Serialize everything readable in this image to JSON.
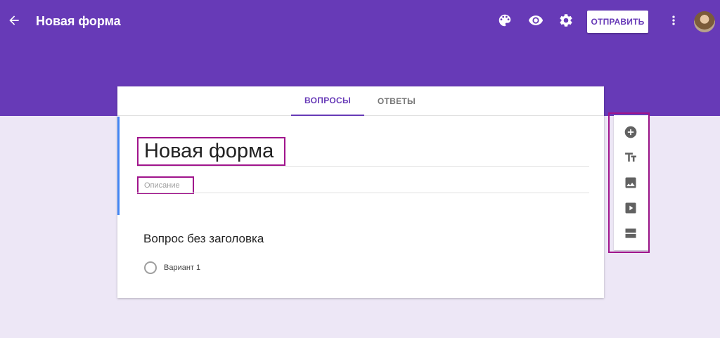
{
  "header": {
    "title": "Новая форма",
    "send_label": "ОТПРАВИТЬ",
    "icons": [
      "arrow-back-icon",
      "palette-icon",
      "eye-icon",
      "gear-icon",
      "more-vert-icon",
      "avatar"
    ]
  },
  "tabs": [
    {
      "label": "ВОПРОСЫ",
      "active": true
    },
    {
      "label": "ОТВЕТЫ",
      "active": false
    }
  ],
  "form": {
    "title": "Новая форма",
    "description_placeholder": "Описание"
  },
  "question": {
    "title": "Вопрос без заголовка",
    "option_label": "Вариант 1"
  },
  "toolbar": {
    "tools": [
      "add-question-icon",
      "title-text-icon",
      "image-icon",
      "video-icon",
      "section-icon"
    ]
  },
  "colors": {
    "brand": "#673ab7",
    "background": "#ede7f6",
    "highlight": "#a0148c",
    "accent": "#4285f4"
  }
}
